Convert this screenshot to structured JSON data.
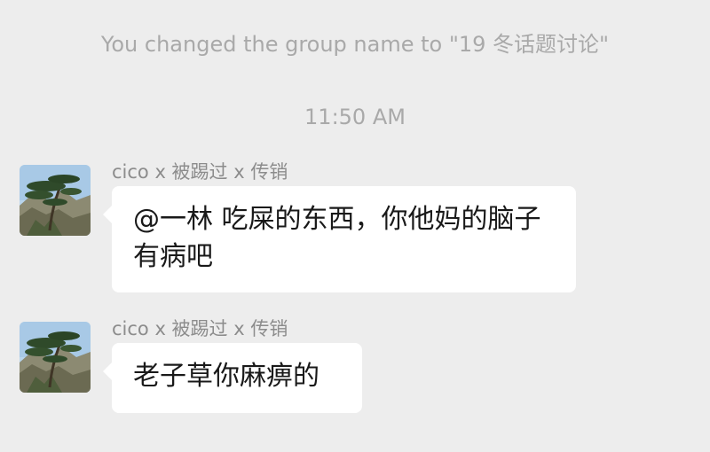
{
  "chat": {
    "system_notice": "You changed the group name to \"19 冬话题讨论\"",
    "timestamp": "11:50 AM",
    "messages": [
      {
        "sender": "cico x 被踢过 x 传销",
        "avatar_icon": "pine-tree-landscape-avatar-icon",
        "text": "@一林 吃屎的东西，你他妈的脑子有病吧"
      },
      {
        "sender": "cico x 被踢过 x 传销",
        "avatar_icon": "pine-tree-landscape-avatar-icon",
        "text": "老子草你麻痹的"
      }
    ]
  },
  "colors": {
    "background": "#ededed",
    "bubble": "#ffffff",
    "meta_text": "#a9a9a9",
    "sender_text": "#8c8c8c",
    "message_text": "#191919"
  }
}
